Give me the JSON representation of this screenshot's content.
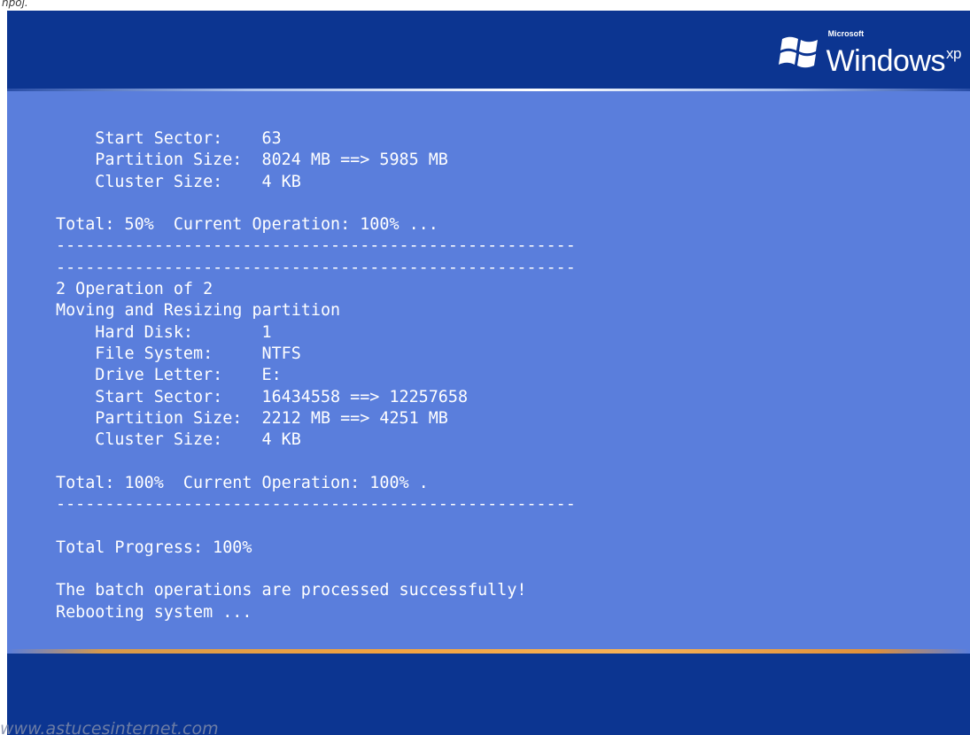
{
  "corner_text": "npoj.",
  "logo": {
    "company": "Microsoft",
    "product": "Windows",
    "edition": "xp"
  },
  "colors": {
    "band": "#0c3591",
    "panel": "#5a7edc",
    "text": "#ffffff",
    "accent_line": "#f3a340"
  },
  "console_lines": [
    "    Start Sector:    63",
    "    Partition Size:  8024 MB ==> 5985 MB",
    "    Cluster Size:    4 KB",
    "",
    "Total: 50%  Current Operation: 100% ...",
    "-----------------------------------------------------",
    "-----------------------------------------------------",
    "2 Operation of 2",
    "Moving and Resizing partition",
    "    Hard Disk:       1",
    "    File System:     NTFS",
    "    Drive Letter:    E:",
    "    Start Sector:    16434558 ==> 12257658",
    "    Partition Size:  2212 MB ==> 4251 MB",
    "    Cluster Size:    4 KB",
    "",
    "Total: 100%  Current Operation: 100% .",
    "-----------------------------------------------------",
    "",
    "Total Progress: 100%",
    "",
    "The batch operations are processed successfully!",
    "Rebooting system ..."
  ],
  "watermark": "www.astucesinternet.com"
}
